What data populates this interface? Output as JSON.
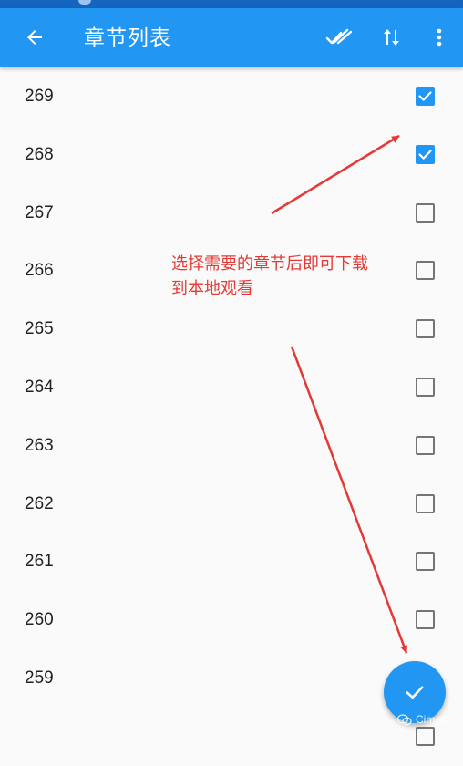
{
  "appbar": {
    "title": "章节列表",
    "back_icon": "arrow-back-icon",
    "select_all_icon": "double-check-icon",
    "sort_icon": "sort-arrows-icon",
    "more_icon": "more-vert-icon",
    "color": "#2196f3"
  },
  "chapters": [
    {
      "number": "269",
      "checked": true
    },
    {
      "number": "268",
      "checked": true
    },
    {
      "number": "267",
      "checked": false
    },
    {
      "number": "266",
      "checked": false
    },
    {
      "number": "265",
      "checked": false
    },
    {
      "number": "264",
      "checked": false
    },
    {
      "number": "263",
      "checked": false
    },
    {
      "number": "262",
      "checked": false
    },
    {
      "number": "261",
      "checked": false
    },
    {
      "number": "260",
      "checked": false
    },
    {
      "number": "259",
      "checked": false
    }
  ],
  "annotation": {
    "line1": "选择需要的章节后即可下载",
    "line2": "到本地观看",
    "color": "#e53935"
  },
  "fab": {
    "icon": "check-icon"
  },
  "watermark": {
    "text": "Cimoc",
    "icon": "wechat-icon"
  }
}
